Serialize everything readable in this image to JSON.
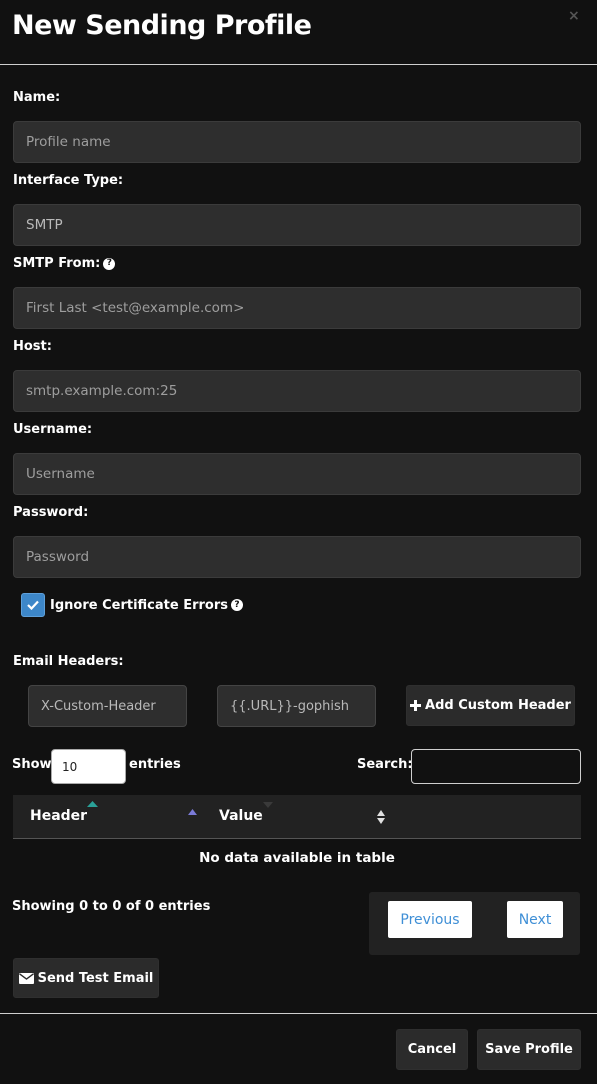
{
  "modal": {
    "title": "New Sending Profile",
    "close_glyph": "×"
  },
  "form": {
    "name": {
      "label": "Name:",
      "placeholder": "Profile name"
    },
    "interface_type": {
      "label": "Interface Type:",
      "value": "SMTP"
    },
    "smtp_from": {
      "label": "SMTP From:",
      "placeholder": "First Last <test@example.com>"
    },
    "host": {
      "label": "Host:",
      "placeholder": "smtp.example.com:25"
    },
    "username": {
      "label": "Username:",
      "placeholder": "Username"
    },
    "password": {
      "label": "Password:",
      "placeholder": "Password"
    },
    "ignore_cert": {
      "label": "Ignore Certificate Errors",
      "checked": true
    }
  },
  "headers": {
    "label": "Email Headers:",
    "header_placeholder": "X-Custom-Header",
    "value_placeholder": "{{.URL}}-gophish",
    "add_button": "Add Custom Header",
    "show_label": "Show",
    "entries_value": "10",
    "entries_label": "entries",
    "search_label": "Search:",
    "columns": [
      "Header",
      "Value"
    ],
    "empty_message": "No data available in table",
    "info": "Showing 0 to 0 of 0 entries",
    "previous": "Previous",
    "next": "Next"
  },
  "actions": {
    "send_test": "Send Test Email",
    "cancel": "Cancel",
    "save": "Save Profile"
  },
  "colors": {
    "background": "#111111",
    "input_bg": "#2e2e2e",
    "checkbox": "#3d87c9",
    "link": "#3f8fd6",
    "sort_active": "#2aa198",
    "sort_asc": "#7b7bd8"
  }
}
